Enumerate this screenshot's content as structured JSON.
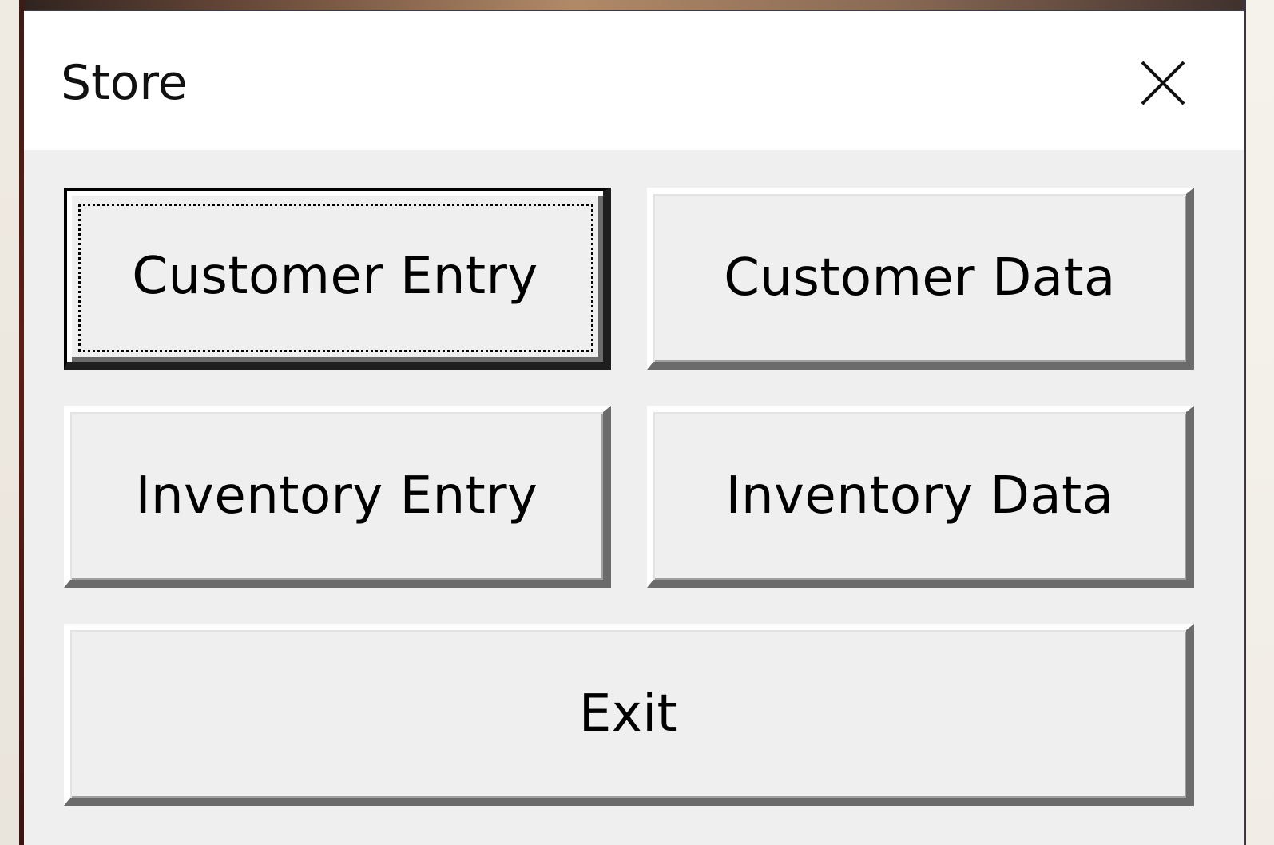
{
  "window": {
    "title": "Store",
    "close_icon": "close-icon"
  },
  "buttons": {
    "customer_entry": "Customer Entry",
    "customer_data": "Customer Data",
    "inventory_entry": "Inventory Entry",
    "inventory_data": "Inventory Data",
    "exit": "Exit"
  },
  "state": {
    "focused_button": "Customer Entry"
  },
  "colors": {
    "dialog_background": "#efefef",
    "titlebar_background": "#ffffff",
    "text": "#000000"
  }
}
